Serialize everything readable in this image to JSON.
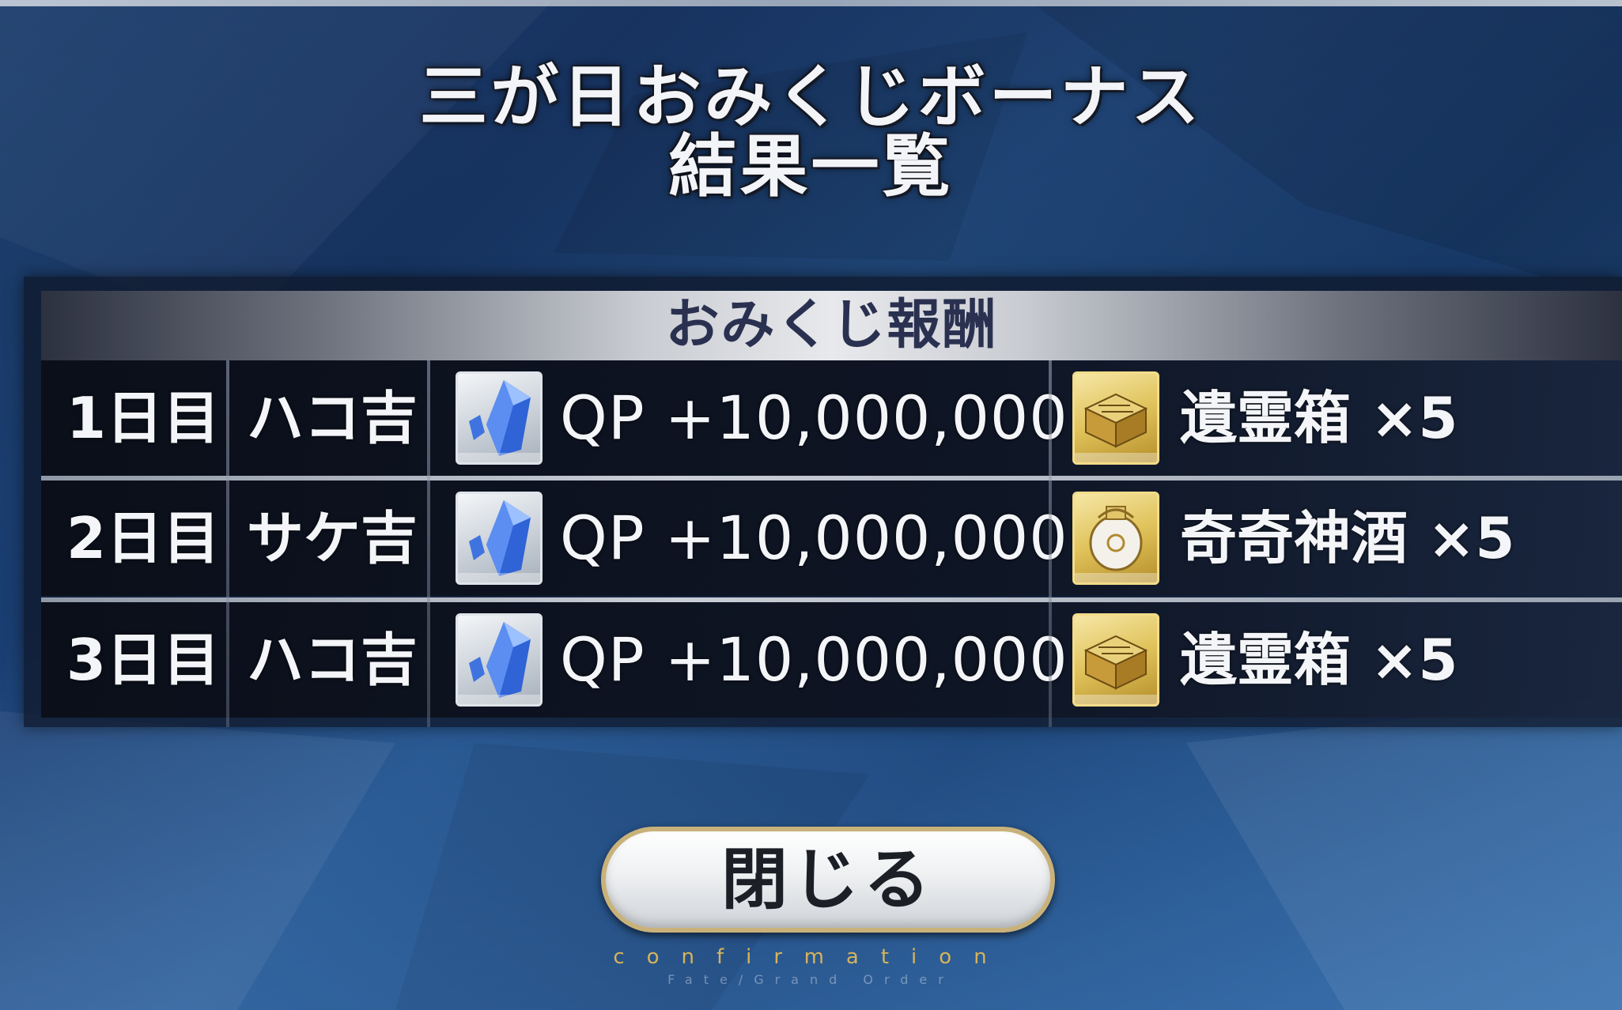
{
  "title": {
    "line1": "三が日おみくじボーナス",
    "line2": "結果一覧"
  },
  "table": {
    "header": "おみくじ報酬",
    "rows": [
      {
        "day": "1日目",
        "fortune": "ハコ吉",
        "reward1_icon": "blue-crystal-qp-icon",
        "reward1_text": "QP +10,000,000",
        "reward2_icon": "gold-chest-icon",
        "reward2_text": "遺霊箱 ×5"
      },
      {
        "day": "2日目",
        "fortune": "サケ吉",
        "reward1_icon": "blue-crystal-qp-icon",
        "reward1_text": "QP +10,000,000",
        "reward2_icon": "sake-vase-icon",
        "reward2_text": "奇奇神酒 ×5"
      },
      {
        "day": "3日目",
        "fortune": "ハコ吉",
        "reward1_icon": "blue-crystal-qp-icon",
        "reward1_text": "QP +10,000,000",
        "reward2_icon": "gold-chest-icon",
        "reward2_text": "遺霊箱 ×5"
      }
    ]
  },
  "close_button": {
    "label": "閉じる"
  },
  "footer": {
    "confirmation": "confirmation",
    "brand": "Fate/Grand Order"
  },
  "colors": {
    "background": "#2a5a92",
    "button_border": "#c9b27a",
    "confirmation_text": "#d6b35a",
    "header_text": "#2a3150"
  }
}
